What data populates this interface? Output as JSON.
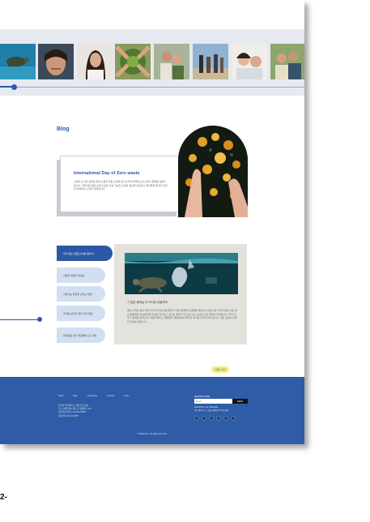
{
  "blog": {
    "title": "Blog",
    "card_title": "International Day of Zero waste",
    "card_text": "산업과 도시의 성장은 환경 오염과 자원 고갈을 증가시키며 세계적으로 쓰레기 문제를 심화시킵니다. 국제 제로 웨이스트의 날은 지속 가능한 소비와 생산을 촉진하고 폐기물을 줄이기 위한 전 세계적인 노력을 장려합니다."
  },
  "nav": {
    "items": [
      "우리 없는 브랜드(이)를 알아서",
      "내용을 세분적 확보된",
      "지속가능 환경을 살리는 방법",
      "우리를 살리기 위한 다른 행동",
      "일회용품 없이 제로웨이스트 계획"
    ]
  },
  "article": {
    "title": "그 많은 폐비닐 다 어디로 갔을까요",
    "text": "매년 수백만 톤의 플라스틱이 바다로 흘러들어가 해양 생물들의 생명을 위협하고 있습니다. 바다거북과 같은 해양 동물들은 비닐봉지를 먹이로 착각하고 삼키는 경우가 많으며, 이는 심각한 건강 문제로 이어집니다. 우리 모두가 일회용 플라스틱 사용을 줄이고 재활용을 생활화하여 깨끗한 바다를 지켜나가야 합니다. 작은 실천이 모여 큰 변화를 만듭니다."
  },
  "cta": {
    "label": "이벤트 참여"
  },
  "footer": {
    "nav": [
      "about",
      "Blog",
      "community",
      "Contact",
      "event"
    ],
    "info": [
      "회사명 우리의지구 | 대표자 홍길동",
      "주소 서울특별시 종로구 세종대로 123",
      "사업자등록번호 123-45-67890",
      "대표전화 02-123-4567"
    ],
    "newsletter_title": "NEWSLETTER",
    "newsletter_placeholder": "Email",
    "newsletter_button": "SEND",
    "newsletter_desc": [
      "Subscribe to our Newsletter",
      "제로 웨이스트 소식을 이메일로 받아보세요."
    ],
    "copyright": "© 2024 Zero. All rights reserved."
  },
  "corner_label": "2-"
}
